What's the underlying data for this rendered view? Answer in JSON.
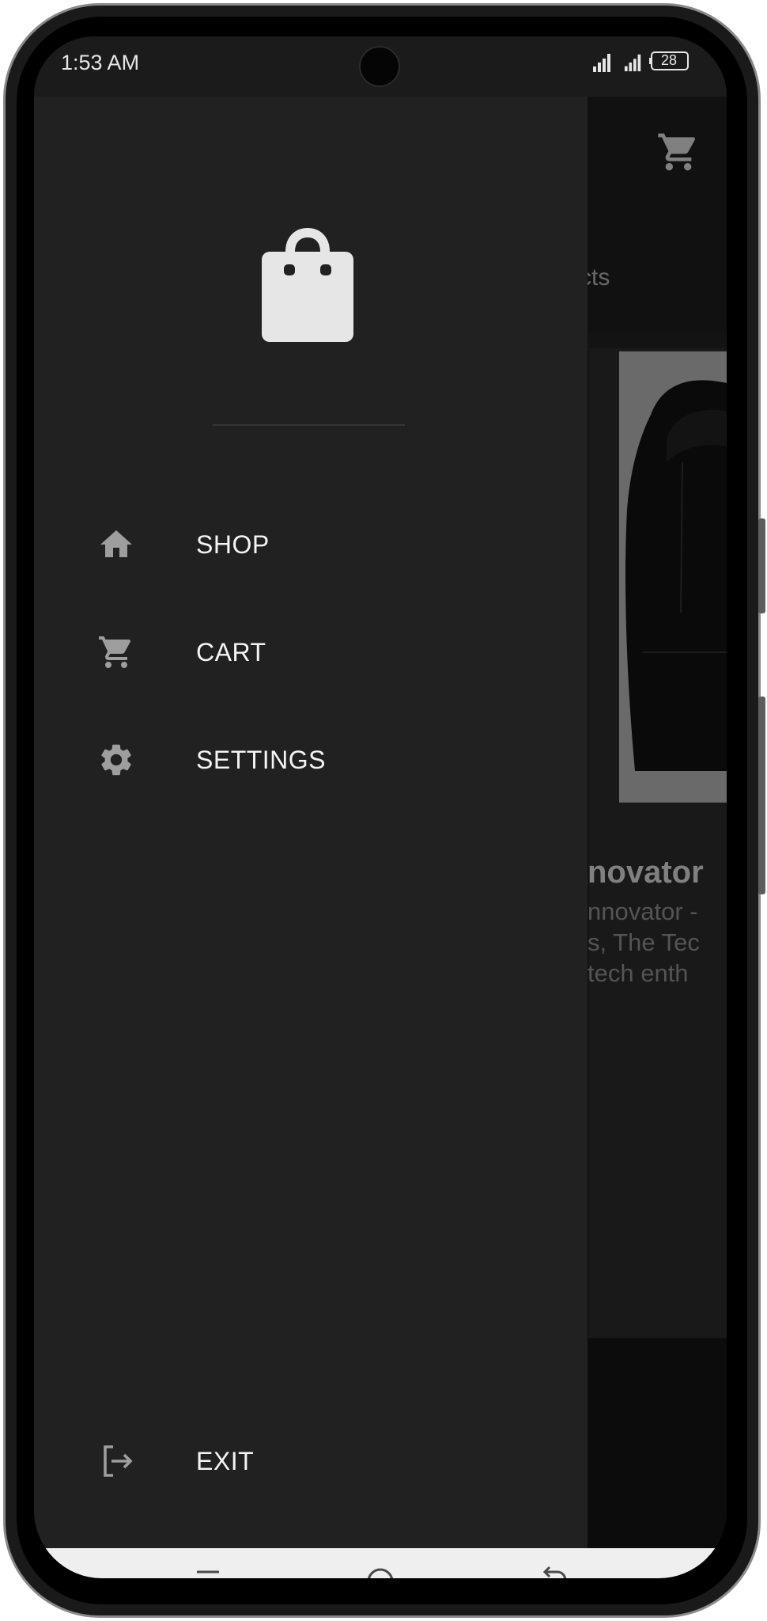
{
  "status_bar": {
    "time": "1:53 AM",
    "battery": "28",
    "icons": [
      "signal-icon",
      "signal-icon",
      "battery-icon"
    ]
  },
  "background_app": {
    "tab_text_fragment": "cts",
    "product": {
      "title_fragment": "novator",
      "desc_lines": [
        "nnovator -",
        "s, The Tec",
        "tech enth"
      ]
    },
    "icons": [
      "cart-icon",
      "hoodie-image"
    ]
  },
  "drawer": {
    "logo_icon": "shopping-bag-icon",
    "items": [
      {
        "label": "SHOP",
        "icon": "home-icon"
      },
      {
        "label": "CART",
        "icon": "cart-icon"
      },
      {
        "label": "SETTINGS",
        "icon": "gear-icon"
      }
    ],
    "exit": {
      "label": "EXIT",
      "icon": "logout-icon"
    }
  },
  "nav_bar": {
    "icons": [
      "menu-lines-icon",
      "home-circle-icon",
      "back-icon"
    ]
  },
  "colors": {
    "drawer_bg": "#212121",
    "icon_gray": "#9e9e9e",
    "label_white": "#f4f4f4",
    "nav_bar_bg": "#efefef"
  }
}
